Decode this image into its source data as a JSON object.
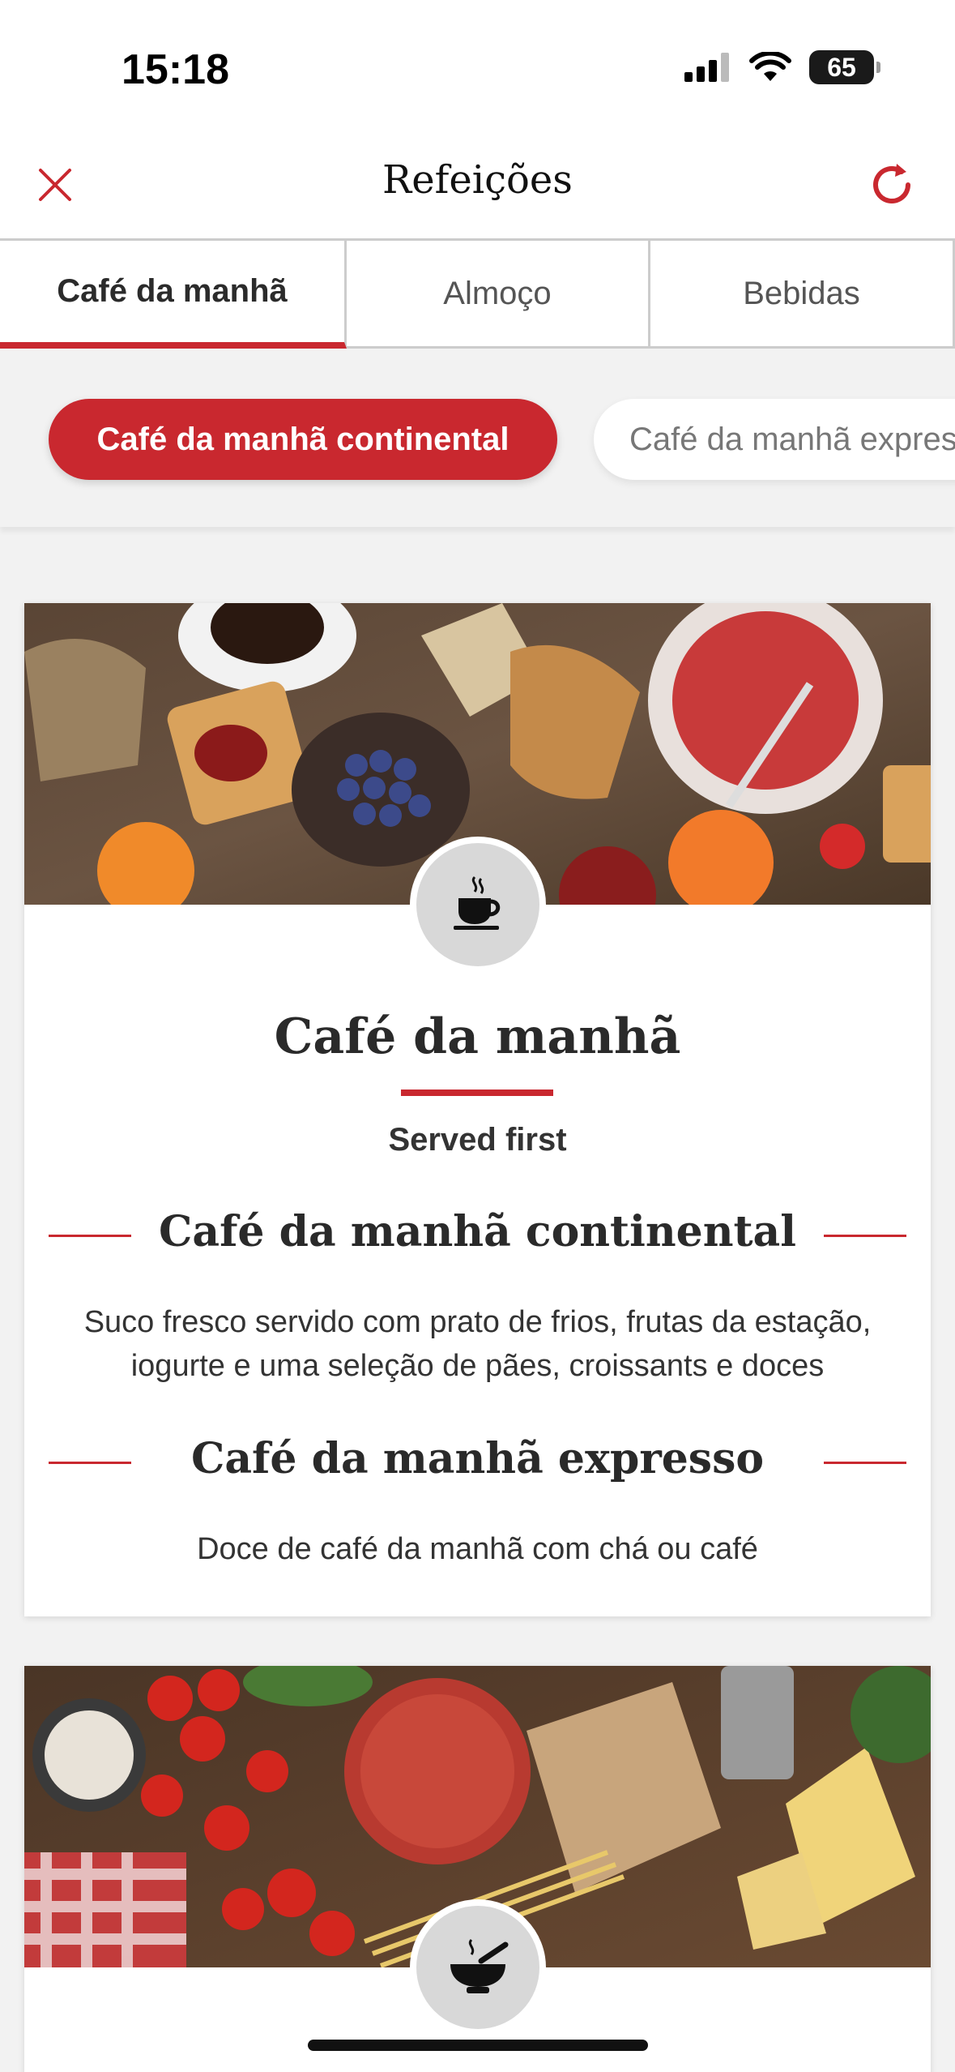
{
  "status_bar": {
    "time": "15:18",
    "battery": "65",
    "battery_level": 0.65
  },
  "nav": {
    "title": "Refeições",
    "close_icon": "close-icon",
    "refresh_icon": "refresh-icon"
  },
  "tabs": [
    {
      "label": "Café da manhã",
      "active": true
    },
    {
      "label": "Almoço",
      "active": false
    },
    {
      "label": "Bebidas",
      "active": false
    }
  ],
  "chips": [
    {
      "label": "Café da manhã continental",
      "active": true
    },
    {
      "label": "Café da manhã expresso",
      "active": false
    }
  ],
  "cards": [
    {
      "icon": "coffee-cup-icon",
      "title": "Café da manhã",
      "subtitle": "Served first",
      "items": [
        {
          "name": "Café da manhã continental",
          "description": "Suco fresco servido com prato de frios, frutas da estação, iogurte e uma seleção de pães, croissants e doces"
        },
        {
          "name": "Café da manhã expresso",
          "description": "Doce de café da manhã com chá ou café"
        }
      ]
    },
    {
      "icon": "soup-bowl-icon"
    }
  ],
  "colors": {
    "accent": "#c9282f",
    "background": "#f2f2f2"
  }
}
